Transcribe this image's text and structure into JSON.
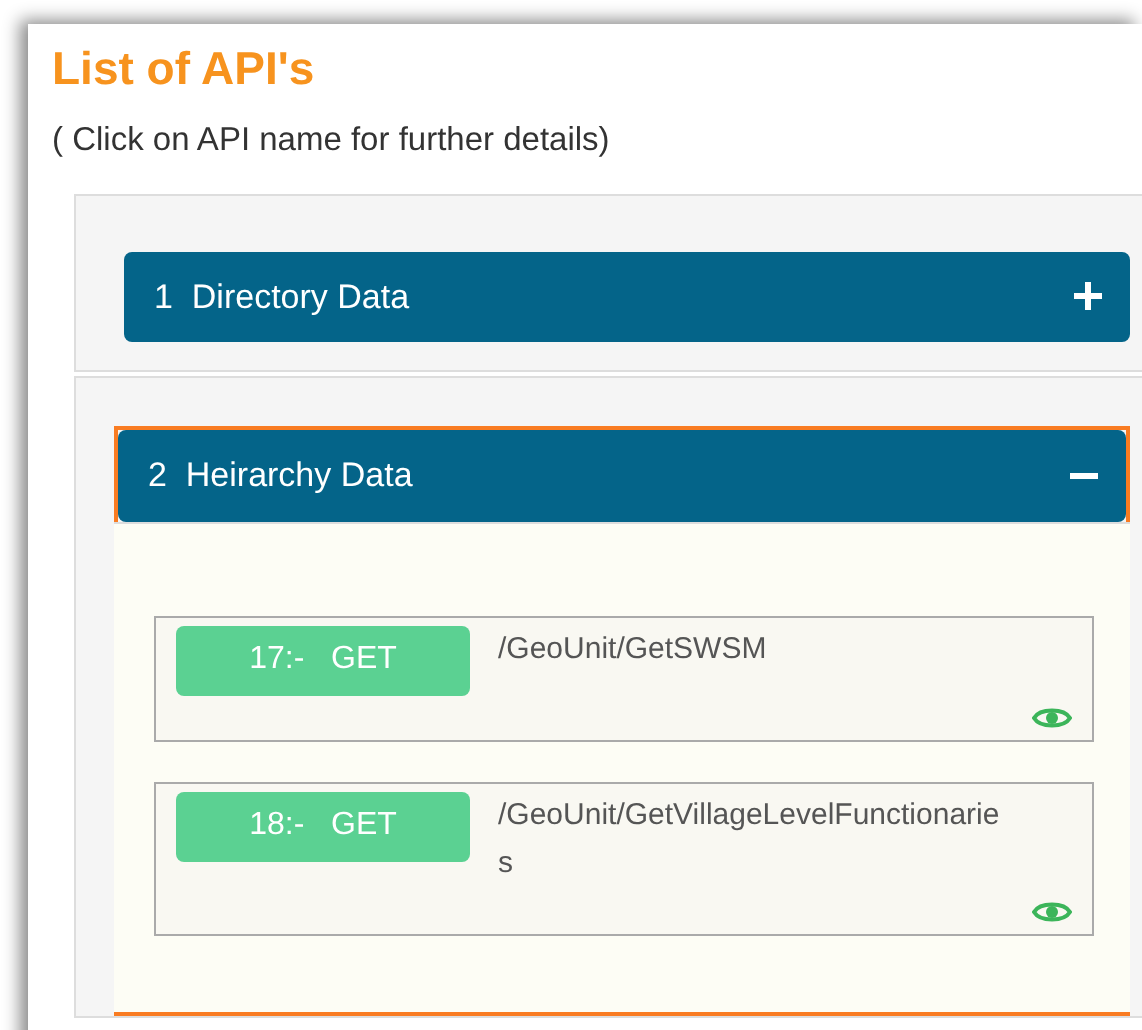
{
  "title": "List of API's",
  "subtitle": "( Click on API name for further details)",
  "sections": [
    {
      "number": "1",
      "name": "Directory Data",
      "expanded": false,
      "highlighted": false
    },
    {
      "number": "2",
      "name": "Heirarchy Data",
      "expanded": true,
      "highlighted": true,
      "endpoints": [
        {
          "index": "17:-",
          "method": "GET",
          "path": "/GeoUnit/GetSWSM"
        },
        {
          "index": "18:-",
          "method": "GET",
          "path": "/GeoUnit/GetVillageLevelFunctionaries"
        }
      ]
    }
  ]
}
